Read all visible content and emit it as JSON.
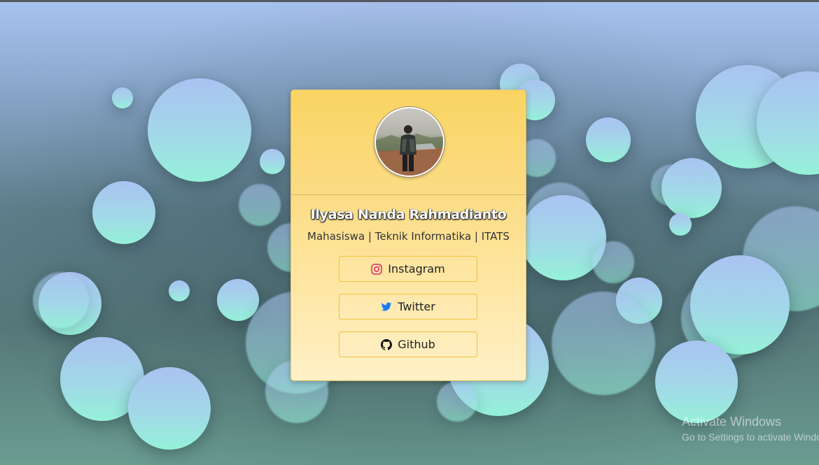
{
  "profile": {
    "name": "Ilyasa Nanda Rahmadianto",
    "subtitle": "Mahasiswa | Teknik Informatika | ITATS"
  },
  "links": [
    {
      "label": "Instagram",
      "icon": "instagram-icon",
      "color": "#e1306c"
    },
    {
      "label": "Twitter",
      "icon": "twitter-icon",
      "color": "#1da1f2"
    },
    {
      "label": "Github",
      "icon": "github-icon",
      "color": "#111111"
    }
  ],
  "watermark": {
    "title": "Activate Windows",
    "subtitle": "Go to Settings to activate Windows."
  },
  "colors": {
    "card_top": "#f9d462",
    "card_bottom": "#fff0c7",
    "button_border": "#f0c23a",
    "bubble_top": "#a9c3f1",
    "bubble_bottom": "#95f1d8"
  }
}
